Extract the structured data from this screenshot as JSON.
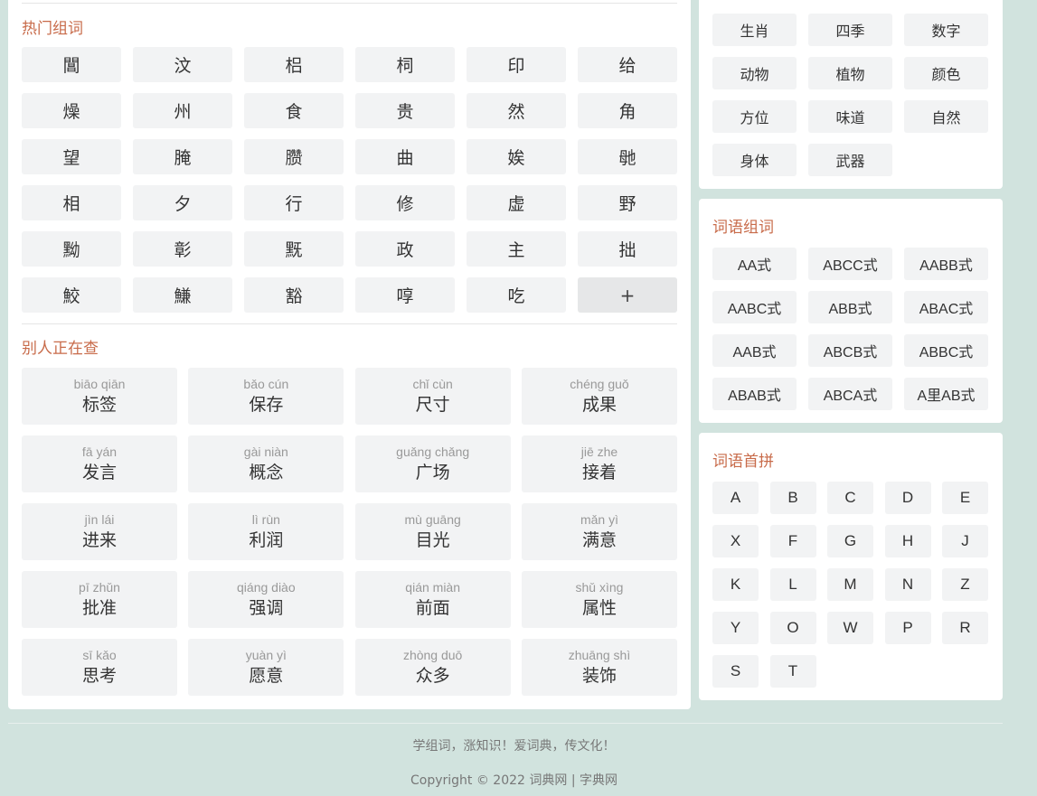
{
  "hot_section": {
    "title": "热门组词",
    "rows": [
      [
        "閶",
        "汶",
        "梠",
        "柌",
        "印",
        "给"
      ],
      [
        "燥",
        "州",
        "食",
        "贵",
        "然",
        "角"
      ],
      [
        "望",
        "腌",
        "臜",
        "曲",
        "娭",
        "毑"
      ],
      [
        "相",
        "夕",
        "行",
        "修",
        "虚",
        "野"
      ],
      [
        "黝",
        "彰",
        "黖",
        "政",
        "主",
        "拙"
      ],
      [
        "鮫",
        "鰜",
        "豁",
        "啍",
        "吃",
        "+"
      ]
    ]
  },
  "recent_section": {
    "title": "别人正在查",
    "rows": [
      [
        {
          "pinyin": "biāo qiān",
          "word": "标签"
        },
        {
          "pinyin": "bǎo cún",
          "word": "保存"
        },
        {
          "pinyin": "chǐ cùn",
          "word": "尺寸"
        },
        {
          "pinyin": "chéng guǒ",
          "word": "成果"
        }
      ],
      [
        {
          "pinyin": "fā yán",
          "word": "发言"
        },
        {
          "pinyin": "gài niàn",
          "word": "概念"
        },
        {
          "pinyin": "guǎng chǎng",
          "word": "广场"
        },
        {
          "pinyin": "jiē zhe",
          "word": "接着"
        }
      ],
      [
        {
          "pinyin": "jìn lái",
          "word": "进来"
        },
        {
          "pinyin": "lì rùn",
          "word": "利润"
        },
        {
          "pinyin": "mù guāng",
          "word": "目光"
        },
        {
          "pinyin": "mǎn yì",
          "word": "满意"
        }
      ],
      [
        {
          "pinyin": "pī zhǔn",
          "word": "批准"
        },
        {
          "pinyin": "qiáng diào",
          "word": "强调"
        },
        {
          "pinyin": "qián miàn",
          "word": "前面"
        },
        {
          "pinyin": "shǔ xìng",
          "word": "属性"
        }
      ],
      [
        {
          "pinyin": "sī kǎo",
          "word": "思考"
        },
        {
          "pinyin": "yuàn yì",
          "word": "愿意"
        },
        {
          "pinyin": "zhòng duō",
          "word": "众多"
        },
        {
          "pinyin": "zhuāng shì",
          "word": "装饰"
        }
      ]
    ]
  },
  "category_section": {
    "items": [
      "生肖",
      "四季",
      "数字",
      "动物",
      "植物",
      "颜色",
      "方位",
      "味道",
      "自然",
      "身体",
      "武器"
    ]
  },
  "pattern_section": {
    "title": "词语组词",
    "items": [
      "AA式",
      "ABCC式",
      "AABB式",
      "AABC式",
      "ABB式",
      "ABAC式",
      "AAB式",
      "ABCB式",
      "ABBC式",
      "ABAB式",
      "ABCA式",
      "A里AB式"
    ]
  },
  "initial_section": {
    "title": "词语首拼",
    "letters": [
      "A",
      "B",
      "C",
      "D",
      "E",
      "X",
      "F",
      "G",
      "H",
      "J",
      "K",
      "L",
      "M",
      "N",
      "Z",
      "Y",
      "O",
      "W",
      "P",
      "R",
      "S",
      "T"
    ]
  },
  "footer": {
    "slogan": "学组词，涨知识！爱词典，传文化！",
    "copyright": "Copyright © 2022 ",
    "link1": "词典网",
    "separator": " | ",
    "link2": "字典网"
  },
  "colors": {
    "background": "#d1e3de",
    "accent": "#c86b4a",
    "tile": "#f2f3f4"
  }
}
